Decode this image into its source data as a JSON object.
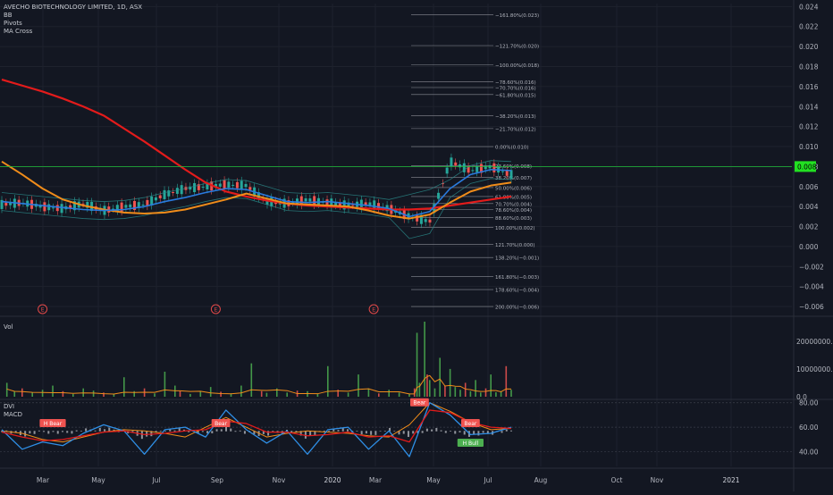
{
  "header": {
    "symbol_line": "AVECHO BIOTECHNOLOGY LIMITED, 1D, ASX",
    "indicators": [
      "BB",
      "Pivots",
      "MA Cross"
    ]
  },
  "volume_pane": {
    "label": "Vol"
  },
  "indicator_pane": {
    "labels": [
      "DVI",
      "MACD"
    ]
  },
  "colors": {
    "background": "#131722",
    "grid": "#1e222d",
    "price_line": "#1fbf3a",
    "ma_long": "#e31b1b",
    "ma_short": "#f08c1a",
    "bb_mid": "#2a7ade",
    "bb_band": "#2a8a8a",
    "candle_up": "#26a69a",
    "candle_down": "#ef5350",
    "macd_line": "#2f8fe6",
    "signal_line": "#e31b1b",
    "dvi_line": "#f08c1a"
  },
  "chart_data": [
    {
      "type": "line",
      "title": "AVECHO BIOTECHNOLOGY LIMITED, 1D, ASX",
      "x_tick_labels": [
        "Mar",
        "May",
        "Jul",
        "Sep",
        "Nov",
        "2020",
        "Mar",
        "May",
        "Jul",
        "Aug",
        "Oct",
        "Nov",
        "2021"
      ],
      "y_tick_labels": [
        "0.024",
        "0.022",
        "0.020",
        "0.018",
        "0.016",
        "0.014",
        "0.012",
        "0.010",
        "0.008",
        "0.006",
        "0.004",
        "0.002",
        "0.000",
        "−0.002",
        "−0.004",
        "−0.006"
      ],
      "ylim": [
        -0.0068,
        0.0243
      ],
      "current_price": {
        "label": "0.008",
        "value": 0.008
      },
      "series": [
        {
          "name": "MA Cross long",
          "x": [
            0,
            0.04,
            0.08,
            0.12,
            0.16,
            0.2,
            0.24,
            0.28,
            0.32,
            0.36,
            0.4,
            0.44,
            0.48,
            0.52,
            0.56,
            0.6,
            0.64,
            0.68,
            0.72,
            0.76,
            0.8,
            0.84,
            0.88,
            0.92,
            0.96,
            1.0
          ],
          "values": [
            0.0167,
            0.0161,
            0.0155,
            0.0148,
            0.014,
            0.0131,
            0.0118,
            0.0105,
            0.0091,
            0.0077,
            0.0064,
            0.0055,
            0.005,
            0.0046,
            0.0043,
            0.0041,
            0.004,
            0.0039,
            0.0038,
            0.0037,
            0.0037,
            0.0038,
            0.0041,
            0.0044,
            0.0047,
            0.005
          ]
        },
        {
          "name": "MA Cross short",
          "x": [
            0,
            0.04,
            0.08,
            0.12,
            0.16,
            0.2,
            0.24,
            0.28,
            0.32,
            0.36,
            0.4,
            0.44,
            0.48,
            0.52,
            0.56,
            0.6,
            0.64,
            0.68,
            0.72,
            0.76,
            0.8,
            0.84,
            0.88,
            0.92,
            0.96,
            1.0
          ],
          "values": [
            0.0085,
            0.0072,
            0.0058,
            0.0047,
            0.0041,
            0.0037,
            0.0034,
            0.0033,
            0.0034,
            0.0037,
            0.0042,
            0.0047,
            0.0053,
            0.0048,
            0.0043,
            0.0042,
            0.0041,
            0.004,
            0.0036,
            0.0031,
            0.0028,
            0.0032,
            0.0044,
            0.0055,
            0.0061,
            0.0064
          ]
        },
        {
          "name": "BB basis",
          "x": [
            0,
            0.04,
            0.08,
            0.12,
            0.16,
            0.2,
            0.24,
            0.28,
            0.32,
            0.36,
            0.4,
            0.44,
            0.48,
            0.52,
            0.56,
            0.6,
            0.64,
            0.68,
            0.72,
            0.76,
            0.8,
            0.84,
            0.88,
            0.92,
            0.96,
            1.0
          ],
          "values": [
            0.0045,
            0.0043,
            0.0041,
            0.0039,
            0.0037,
            0.0036,
            0.0037,
            0.004,
            0.0045,
            0.0049,
            0.0054,
            0.0058,
            0.0057,
            0.0051,
            0.0045,
            0.0044,
            0.0045,
            0.0043,
            0.0041,
            0.0038,
            0.003,
            0.0035,
            0.0058,
            0.0072,
            0.0077,
            0.0076
          ]
        },
        {
          "name": "Price",
          "x": [
            0,
            0.04,
            0.08,
            0.12,
            0.16,
            0.2,
            0.24,
            0.28,
            0.32,
            0.36,
            0.4,
            0.44,
            0.48,
            0.52,
            0.56,
            0.6,
            0.64,
            0.68,
            0.72,
            0.76,
            0.8,
            0.84,
            0.88,
            0.92,
            0.96,
            1.0
          ],
          "values": [
            0.0042,
            0.0044,
            0.004,
            0.0038,
            0.0043,
            0.0036,
            0.004,
            0.0042,
            0.0052,
            0.0058,
            0.006,
            0.0062,
            0.0061,
            0.0045,
            0.0043,
            0.0047,
            0.0044,
            0.0041,
            0.0043,
            0.0038,
            0.003,
            0.0025,
            0.0085,
            0.0076,
            0.008,
            0.0072
          ]
        }
      ],
      "fib_levels": [
        {
          "label": "−161.80%(0.023)",
          "value": 0.0232
        },
        {
          "label": "−121.70%(0.020)",
          "value": 0.0201
        },
        {
          "label": "−100.00%(0.018)",
          "value": 0.0182
        },
        {
          "label": "−78.60%(0.016)",
          "value": 0.0165
        },
        {
          "label": "−70.70%(0.016)",
          "value": 0.0159
        },
        {
          "label": "−61.80%(0.015)",
          "value": 0.0152
        },
        {
          "label": "−38.20%(0.013)",
          "value": 0.0131
        },
        {
          "label": "−21.70%(0.012)",
          "value": 0.0118
        },
        {
          "label": "0.00%(0.010)",
          "value": 0.01
        },
        {
          "label": "23.60%(0.008)",
          "value": 0.0081
        },
        {
          "label": "38.20%(0.007)",
          "value": 0.0069
        },
        {
          "label": "50.00%(0.006)",
          "value": 0.0059
        },
        {
          "label": "61.80%(0.005)",
          "value": 0.005
        },
        {
          "label": "70.70%(0.004)",
          "value": 0.0043
        },
        {
          "label": "78.60%(0.004)",
          "value": 0.0037
        },
        {
          "label": "88.60%(0.003)",
          "value": 0.0029
        },
        {
          "label": "100.00%(0.002)",
          "value": 0.0019
        },
        {
          "label": "121.70%(0.000)",
          "value": 0.0002
        },
        {
          "label": "138.20%(−0.001)",
          "value": -0.0011
        },
        {
          "label": "161.80%(−0.003)",
          "value": -0.003
        },
        {
          "label": "178.60%(−0.004)",
          "value": -0.0043
        },
        {
          "label": "200.00%(−0.006)",
          "value": -0.006
        }
      ],
      "event_markers": [
        {
          "label": "E",
          "x": 0.08
        },
        {
          "label": "E",
          "x": 0.42
        },
        {
          "label": "E",
          "x": 0.73
        }
      ]
    },
    {
      "type": "bar",
      "title": "Vol",
      "y_tick_labels": [
        "20000000.0",
        "10000000.0",
        "0.0"
      ],
      "ylim": [
        0,
        27000000
      ],
      "x": [
        0.01,
        0.025,
        0.04,
        0.06,
        0.08,
        0.1,
        0.12,
        0.14,
        0.16,
        0.18,
        0.2,
        0.22,
        0.24,
        0.26,
        0.28,
        0.3,
        0.32,
        0.34,
        0.35,
        0.37,
        0.39,
        0.41,
        0.43,
        0.45,
        0.47,
        0.49,
        0.51,
        0.52,
        0.54,
        0.56,
        0.58,
        0.6,
        0.62,
        0.64,
        0.66,
        0.68,
        0.7,
        0.72,
        0.74,
        0.76,
        0.78,
        0.8,
        0.81,
        0.815,
        0.82,
        0.83,
        0.835,
        0.84,
        0.85,
        0.86,
        0.87,
        0.88,
        0.89,
        0.9,
        0.91,
        0.92,
        0.93,
        0.94,
        0.95,
        0.96,
        0.97,
        0.98,
        0.99,
        1.0
      ],
      "values": [
        5000000,
        2000000,
        3000000,
        1500000,
        2500000,
        4000000,
        2000000,
        1000000,
        3000000,
        2200000,
        1500000,
        1000000,
        7000000,
        2000000,
        3000000,
        1200000,
        9000000,
        4000000,
        2000000,
        1000000,
        2000000,
        3500000,
        1800000,
        1200000,
        4000000,
        12000000,
        2000000,
        1400000,
        3000000,
        1500000,
        2200000,
        2000000,
        1000000,
        11000000,
        2500000,
        1500000,
        8000000,
        3000000,
        1200000,
        2500000,
        1500000,
        1000000,
        3000000,
        23000000,
        5000000,
        27000000,
        8000000,
        6000000,
        3000000,
        14000000,
        4000000,
        10000000,
        3500000,
        2500000,
        5000000,
        2000000,
        6000000,
        1500000,
        3000000,
        8000000,
        1600000,
        2000000,
        11000000,
        2500000
      ]
    },
    {
      "type": "line",
      "title": "DVI / MACD",
      "y_tick_labels": [
        "80.00",
        "60.00",
        "40.00"
      ],
      "ylim": [
        28,
        82
      ],
      "annotations": [
        {
          "label": "H Bear",
          "x": 0.1,
          "kind": "bear"
        },
        {
          "label": "Bear",
          "x": 0.43,
          "kind": "bear"
        },
        {
          "label": "Bear",
          "x": 0.82,
          "kind": "bear"
        },
        {
          "label": "Bear",
          "x": 0.92,
          "kind": "bear"
        },
        {
          "label": "H Bull",
          "x": 0.92,
          "kind": "bull"
        }
      ],
      "series": [
        {
          "name": "DVI",
          "x": [
            0,
            0.04,
            0.08,
            0.12,
            0.16,
            0.2,
            0.24,
            0.28,
            0.32,
            0.36,
            0.4,
            0.44,
            0.48,
            0.52,
            0.56,
            0.6,
            0.64,
            0.68,
            0.72,
            0.76,
            0.8,
            0.84,
            0.88,
            0.92,
            0.96,
            1.0
          ],
          "values": [
            57,
            55,
            50,
            48,
            52,
            56,
            58,
            57,
            55,
            52,
            60,
            68,
            60,
            52,
            55,
            57,
            56,
            55,
            53,
            52,
            62,
            80,
            73,
            64,
            58,
            59
          ]
        },
        {
          "name": "MACD",
          "x": [
            0,
            0.04,
            0.08,
            0.12,
            0.16,
            0.2,
            0.24,
            0.28,
            0.32,
            0.36,
            0.4,
            0.44,
            0.48,
            0.52,
            0.56,
            0.6,
            0.64,
            0.68,
            0.72,
            0.76,
            0.8,
            0.84,
            0.88,
            0.92,
            0.96,
            1.0
          ],
          "values": [
            58,
            42,
            48,
            45,
            55,
            62,
            57,
            38,
            58,
            60,
            52,
            74,
            58,
            47,
            57,
            38,
            58,
            60,
            42,
            57,
            36,
            80,
            70,
            54,
            55,
            60
          ]
        },
        {
          "name": "Signal",
          "x": [
            0,
            0.04,
            0.08,
            0.12,
            0.16,
            0.2,
            0.24,
            0.28,
            0.32,
            0.36,
            0.4,
            0.44,
            0.48,
            0.52,
            0.56,
            0.6,
            0.64,
            0.68,
            0.72,
            0.76,
            0.8,
            0.84,
            0.88,
            0.92,
            0.96,
            1.0
          ],
          "values": [
            56,
            52,
            49,
            50,
            53,
            56,
            57,
            54,
            55,
            57,
            58,
            65,
            63,
            56,
            56,
            53,
            54,
            56,
            52,
            53,
            48,
            74,
            72,
            64,
            60,
            59
          ]
        }
      ]
    }
  ]
}
